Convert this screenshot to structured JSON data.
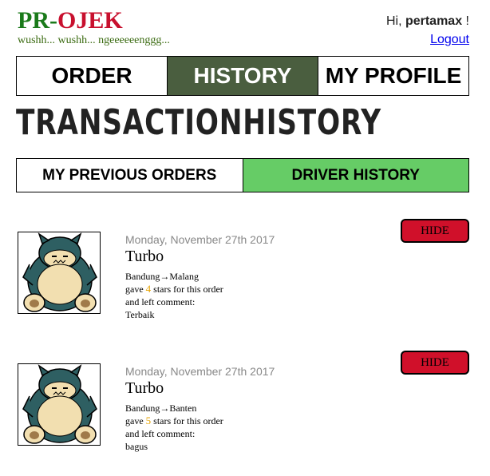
{
  "brand": {
    "pr": "PR",
    "dash": "-",
    "ojek": "OJEK",
    "tagline": "wushh... wushh... ngeeeeeenggg..."
  },
  "user": {
    "greeting_prefix": "Hi, ",
    "username": "pertamax",
    "greeting_suffix": " !",
    "logout_label": "Logout"
  },
  "nav": {
    "tabs": [
      {
        "label": "ORDER"
      },
      {
        "label": "HISTORY",
        "active": true
      },
      {
        "label": "MY PROFILE"
      }
    ]
  },
  "page": {
    "title": "TRANSACTIONHISTORY"
  },
  "subtabs": [
    {
      "label": "MY PREVIOUS ORDERS"
    },
    {
      "label": "DRIVER HISTORY",
      "active": true
    }
  ],
  "orders": [
    {
      "date": "Monday, November 27th 2017",
      "driver": "Turbo",
      "origin": "Bandung",
      "arrow": "→",
      "destination": "Malang",
      "gave": "gave ",
      "stars": "4",
      "stars_suffix": " stars for this order",
      "comment_label": "and left comment:",
      "comment": "Terbaik",
      "hide_label": "HIDE"
    },
    {
      "date": "Monday, November 27th 2017",
      "driver": "Turbo",
      "origin": "Bandung",
      "arrow": "→",
      "destination": "Banten",
      "gave": "gave ",
      "stars": "5",
      "stars_suffix": " stars for this order",
      "comment_label": "and left comment:",
      "comment": "bagus",
      "hide_label": "HIDE"
    }
  ],
  "colors": {
    "brand_green": "#1a7a1a",
    "brand_red": "#c8102e",
    "nav_active": "#4a5e3f",
    "subtab_active": "#66cc66",
    "hide_button": "#d0102a",
    "stars": "#e6a200"
  },
  "icons": {
    "avatar": "snorlax-avatar-icon"
  }
}
